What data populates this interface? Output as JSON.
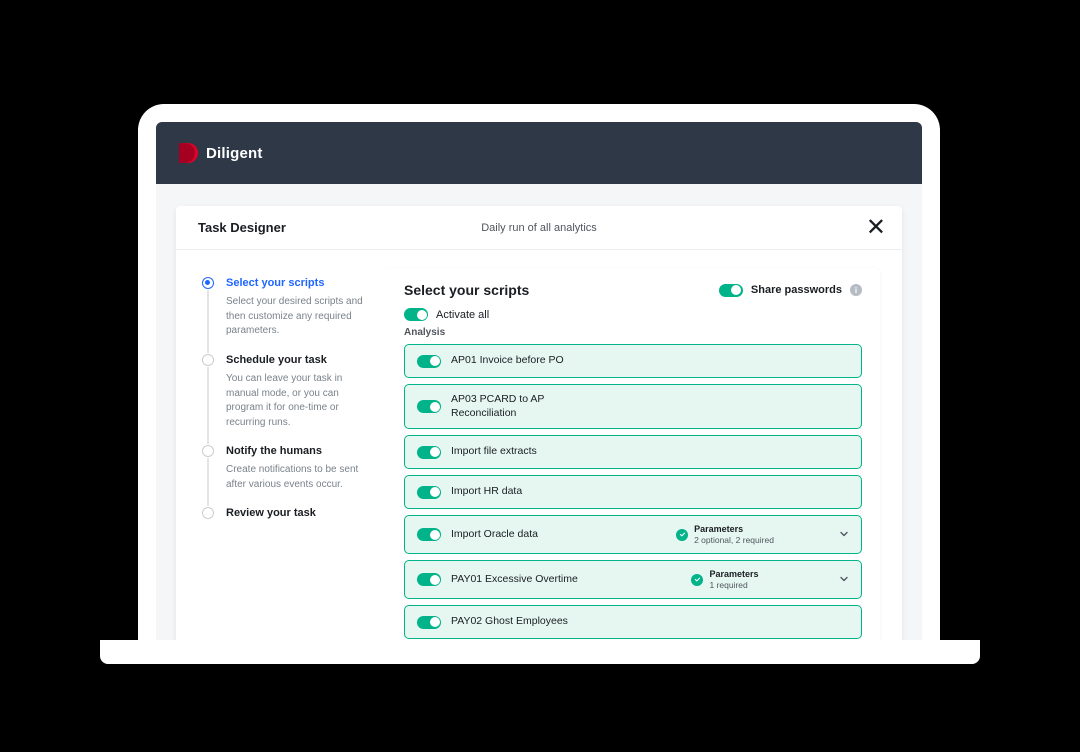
{
  "brand": {
    "name": "Diligent"
  },
  "dialog": {
    "title": "Task Designer",
    "subtitle": "Daily run of all analytics"
  },
  "stepper": [
    {
      "title": "Select your scripts",
      "desc": "Select your desired scripts and then customize any required parameters.",
      "active": true
    },
    {
      "title": "Schedule your task",
      "desc": "You can leave your task in manual mode, or you can program it for one-time or recurring runs."
    },
    {
      "title": "Notify the humans",
      "desc": "Create notifications to be sent after various events occur."
    },
    {
      "title": "Review your task",
      "desc": ""
    }
  ],
  "panel": {
    "heading": "Select your scripts",
    "share_label": "Share passwords",
    "activate_all": "Activate all",
    "section": "Analysis",
    "params_label": "Parameters",
    "scripts": [
      {
        "name": "AP01 Invoice before PO"
      },
      {
        "name": "AP03 PCARD to AP Reconciliation"
      },
      {
        "name": "Import file extracts"
      },
      {
        "name": "Import HR  data"
      },
      {
        "name": "Import Oracle data",
        "params": "2 optional, 2 required"
      },
      {
        "name": "PAY01 Excessive Overtime",
        "params": "1 required"
      },
      {
        "name": "PAY02 Ghost Employees"
      }
    ]
  }
}
